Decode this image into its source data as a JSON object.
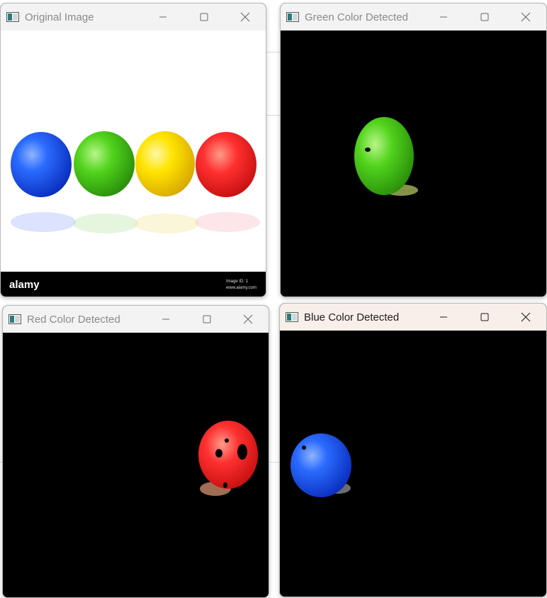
{
  "windows": {
    "original": {
      "title": "Original Image"
    },
    "green": {
      "title": "Green Color Detected"
    },
    "red": {
      "title": "Red Color Detected"
    },
    "blue": {
      "title": "Blue Color Detected"
    }
  },
  "original_image": {
    "banner_brand": "alamy",
    "banner_id": "Image ID: 1",
    "banner_site": "www.alamy.com"
  },
  "icons": {
    "minimize": "minimize-icon",
    "maximize": "maximize-icon",
    "close": "close-icon",
    "app": "app-icon"
  },
  "colors": {
    "blue_ball": "#1f5cff",
    "green_ball": "#4fd11a",
    "yellow_ball": "#ffe000",
    "red_ball": "#ff2a2a",
    "titlebar": "#f3f3f3",
    "titlebar_active": "#f9efe9"
  }
}
